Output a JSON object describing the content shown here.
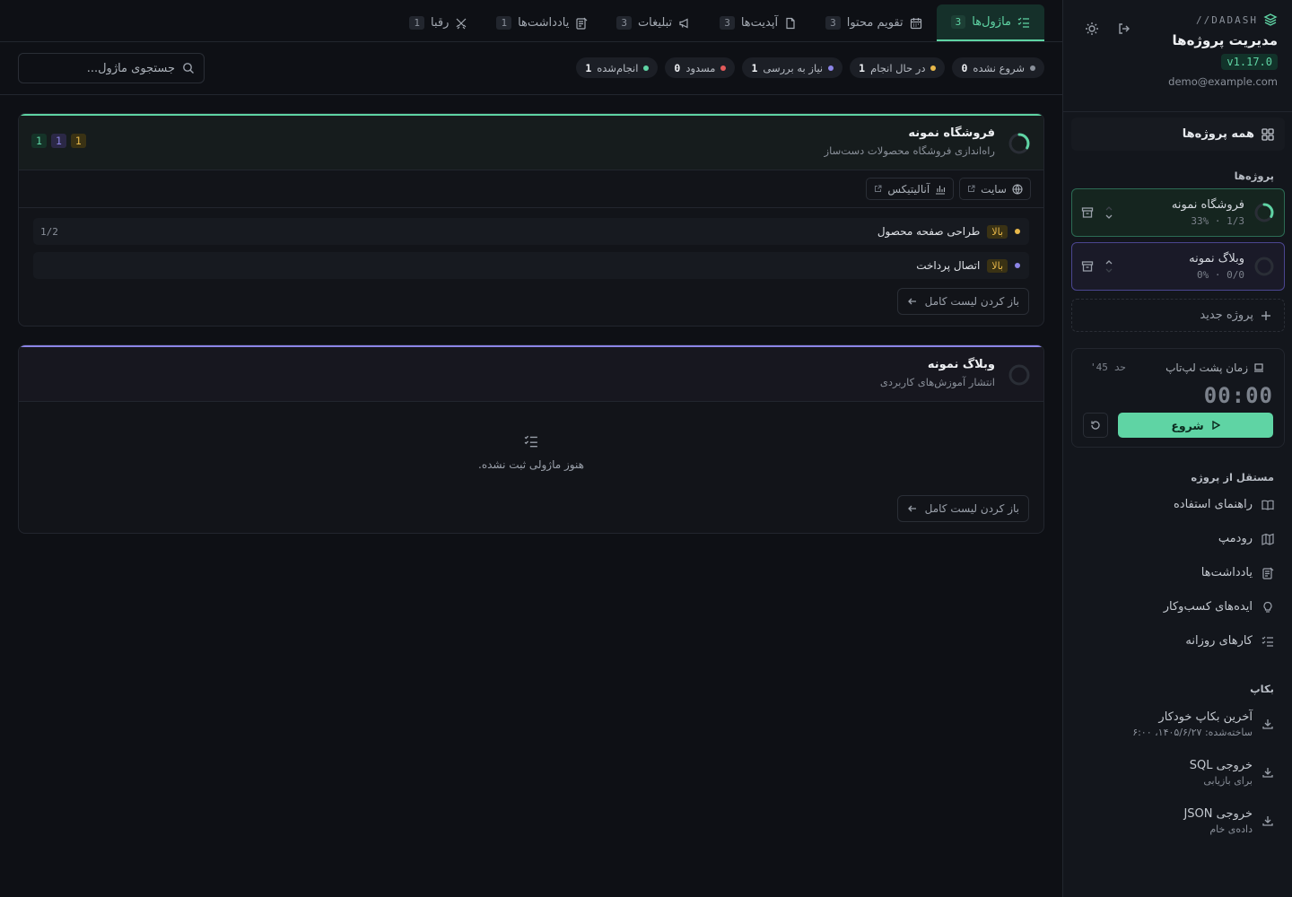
{
  "sidebar": {
    "brand_small": "DADASH//",
    "title": "مدیریت پروژه‌ها",
    "version": "v1.17.0",
    "email": "demo@example.com",
    "all_projects": "همه پروژه‌ها",
    "projects_label": "پروژه‌ها",
    "projects": [
      {
        "name": "فروشگاه نمونه",
        "meta": "1/3 · 33%",
        "progress": 0.33,
        "color": "#5fd4a4"
      },
      {
        "name": "وبلاگ نمونه",
        "meta": "0/0 · 0%",
        "progress": 0,
        "color": "#8b84e6"
      }
    ],
    "new_project": "پروژه جدید",
    "timer": {
      "label": "زمان پشت لپ‌تاپ",
      "limit": "حد 45'",
      "time": "00:00",
      "start": "شروع"
    },
    "independent_label": "مستقل از پروژه",
    "nav": [
      {
        "label": "راهنمای استفاده",
        "icon": "book-icon"
      },
      {
        "label": "رودمپ",
        "icon": "map-icon"
      },
      {
        "label": "یادداشت‌ها",
        "icon": "note-icon"
      },
      {
        "label": "ایده‌های کسب‌وکار",
        "icon": "bulb-icon"
      },
      {
        "label": "کارهای روزانه",
        "icon": "checklist-icon"
      }
    ],
    "backup_label": "بکاپ",
    "backups": [
      {
        "title": "آخرین بکاپ خودکار",
        "sub": "ساخته‌شده: ۱۴۰۵/۶/۲۷، ۶:۰۰"
      },
      {
        "title": "خروجی SQL",
        "sub": "برای بازیابی"
      },
      {
        "title": "خروجی JSON",
        "sub": "داده‌ی خام"
      }
    ]
  },
  "tabs": [
    {
      "label": "ماژول‌ها",
      "count": "3",
      "icon": "checklist-icon",
      "active": true
    },
    {
      "label": "تقویم محتوا",
      "count": "3",
      "icon": "calendar-icon"
    },
    {
      "label": "آپدیت‌ها",
      "count": "3",
      "icon": "file-icon"
    },
    {
      "label": "تبلیغات",
      "count": "3",
      "icon": "megaphone-icon"
    },
    {
      "label": "یادداشت‌ها",
      "count": "1",
      "icon": "note-icon"
    },
    {
      "label": "رقبا",
      "count": "1",
      "icon": "swords-icon"
    }
  ],
  "search": {
    "placeholder": "جستجوی ماژول..."
  },
  "statuses": [
    {
      "label": "شروع نشده",
      "count": "0",
      "color": "#8a909a"
    },
    {
      "label": "در حال انجام",
      "count": "1",
      "color": "#e8b84a"
    },
    {
      "label": "نیاز به بررسی",
      "count": "1",
      "color": "#8b84e6"
    },
    {
      "label": "مسدود",
      "count": "0",
      "color": "#e25a5a"
    },
    {
      "label": "انجام‌شده",
      "count": "1",
      "color": "#5fd4a4"
    }
  ],
  "cards": [
    {
      "title": "فروشگاه نمونه",
      "subtitle": "راه‌اندازی فروشگاه محصولات دست‌ساز",
      "badges": [
        "1",
        "1",
        "1"
      ],
      "links": [
        "سایت",
        "آنالیتیکس"
      ],
      "modules": [
        {
          "priority": "بالا",
          "name": "طراحی صفحه محصول",
          "frac": "1/2",
          "dot": "#e8b84a"
        },
        {
          "priority": "بالا",
          "name": "اتصال پرداخت",
          "frac": "",
          "dot": "#8b84e6"
        }
      ],
      "open": "باز کردن لیست کامل"
    },
    {
      "title": "وبلاگ نمونه",
      "subtitle": "انتشار آموزش‌های کاربردی",
      "empty": "هنوز ماژولی ثبت نشده.",
      "open": "باز کردن لیست کامل"
    }
  ]
}
